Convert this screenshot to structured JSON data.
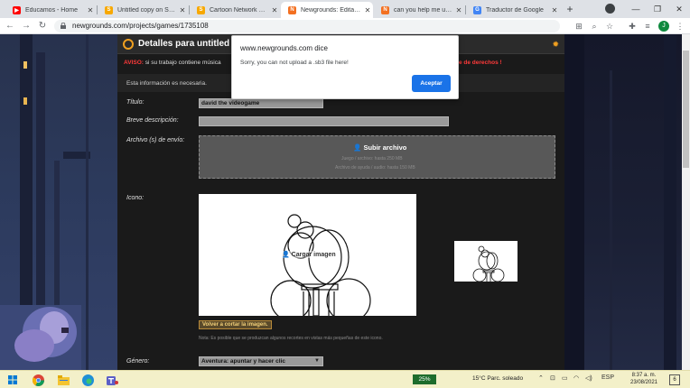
{
  "tabs": [
    {
      "title": "Educamos - Home",
      "icon": "youtube-icon",
      "color": "#ff0000",
      "active": false
    },
    {
      "title": "Untitled copy on Scratch",
      "icon": "scratch-icon",
      "color": "#f7a800",
      "active": false
    },
    {
      "title": "Cartoon Network Hotel",
      "icon": "scratch-icon",
      "color": "#f7a800",
      "active": false
    },
    {
      "title": "Newgrounds: Editando",
      "icon": "newgrounds-icon",
      "color": "#f37021",
      "active": true
    },
    {
      "title": "can you help me upload",
      "icon": "newgrounds-icon",
      "color": "#f37021",
      "active": false
    },
    {
      "title": "Traductor de Google",
      "icon": "google-translate-icon",
      "color": "#4285f4",
      "active": false
    }
  ],
  "address": {
    "url": "newgrounds.com/projects/games/1735108"
  },
  "profile_initial": "J",
  "panel": {
    "title": "Detalles para untitled # 17",
    "warning_label": "AVISO:",
    "warning_text": "si su trabajo contiene música",
    "warning_tail": "e de derechos !",
    "info": "Esta información es necesaria."
  },
  "form": {
    "title_label": "Título:",
    "title_value": "david the videogame",
    "desc_label": "Breve descripción:",
    "desc_value": "",
    "files_label": "Archivo (s) de envío:",
    "upload_label": "Subir archivo",
    "upload_hint1": "Juego / archivo: hasta 250 MB",
    "upload_hint2": "Archivo de ayuda / audio: hasta 150 MB",
    "icon_label": "Icono:",
    "load_image_label": "Cargar imagen",
    "recrop_label": "Volver a cortar la imagen.",
    "note": "Nota: Es posible que se produzcan algunos recortes en vistas más pequeñas de este icono.",
    "genre_label": "Género:",
    "genre_value": "Aventura: apuntar y hacer clic"
  },
  "dialog": {
    "origin": "www.newgrounds.com dice",
    "message": "Sorry, you can not upload a .sb3 file here!",
    "ok_label": "Aceptar"
  },
  "taskbar": {
    "battery": "25%",
    "weather": "15°C  Parc. soleado",
    "lang": "ESP",
    "time": "8:37 a. m.",
    "date": "23/08/2021",
    "notifications": "6"
  }
}
